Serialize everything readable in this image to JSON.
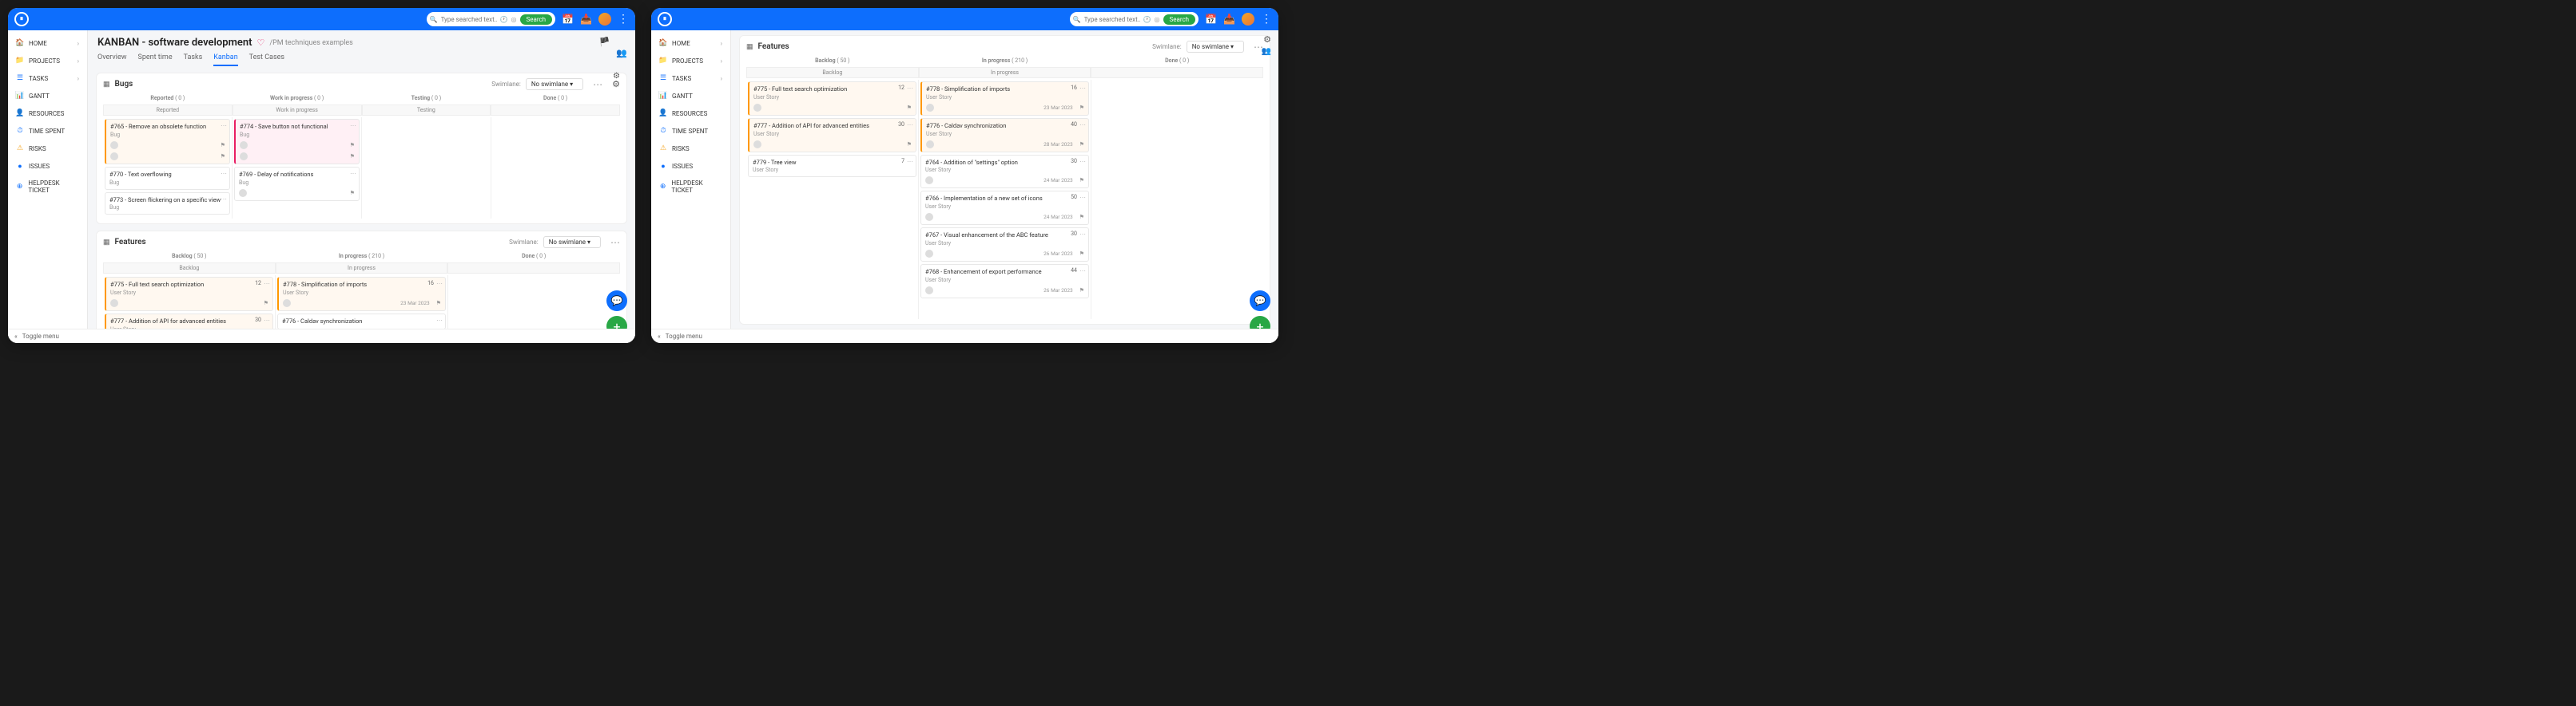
{
  "search": {
    "placeholder": "Type searched text...",
    "btn": "Search"
  },
  "sidebar": {
    "items": [
      {
        "icon": "🏠",
        "label": "HOME",
        "chev": true,
        "color": "#0d6efd"
      },
      {
        "icon": "📁",
        "label": "PROJECTS",
        "chev": true,
        "color": "#0d6efd"
      },
      {
        "icon": "☰",
        "label": "TASKS",
        "chev": true,
        "color": "#0d6efd"
      },
      {
        "icon": "📊",
        "label": "GANTT",
        "color": "#0d6efd"
      },
      {
        "icon": "👤",
        "label": "RESOURCES",
        "color": "#0d6efd"
      },
      {
        "icon": "⏱",
        "label": "TIME SPENT",
        "color": "#0d6efd"
      },
      {
        "icon": "⚠",
        "label": "RISKS",
        "color": "#f5a623"
      },
      {
        "icon": "●",
        "label": "ISSUES",
        "color": "#0d6efd"
      },
      {
        "icon": "⊕",
        "label": "HELPDESK TICKET",
        "color": "#0d6efd"
      }
    ]
  },
  "page": {
    "title": "KANBAN - software development",
    "breadcrumb": "/PM techniques examples",
    "tabs": [
      "Overview",
      "Spent time",
      "Tasks",
      "Kanban",
      "Test Cases"
    ],
    "active_tab": "Kanban"
  },
  "swim": {
    "label": "Swimlane:",
    "value": "No swimlane"
  },
  "bugs": {
    "title": "Bugs",
    "cols_head": [
      {
        "label": "Reported",
        "count": "( 0 )"
      },
      {
        "label": "Work in progress",
        "count": "( 0 )"
      },
      {
        "label": "Testing",
        "count": "( 0 )"
      },
      {
        "label": "Done",
        "count": "( 0 )"
      }
    ],
    "cols_sub": [
      "Reported",
      "Work in progress",
      "Testing",
      ""
    ],
    "col0": [
      {
        "t": "#765 - Remove an obsolete function",
        "s": "Bug",
        "cls": "orange"
      },
      {
        "t": "#770 - Text overflowing",
        "s": "Bug"
      },
      {
        "t": "#773 - Screen flickering on a specific view",
        "s": "Bug"
      }
    ],
    "col1": [
      {
        "t": "#774 - Save button not functional",
        "s": "Bug",
        "cls": "pink"
      },
      {
        "t": "#769 - Delay of notifications",
        "s": "Bug"
      }
    ]
  },
  "features_a": {
    "title": "Features",
    "cols_head": [
      {
        "label": "Backlog",
        "count": "( 50 )"
      },
      {
        "label": "In progress",
        "count": "( 210 )"
      },
      {
        "label": "Done",
        "count": "( 0 )"
      }
    ],
    "cols_sub": [
      "Backlog",
      "In progress",
      ""
    ],
    "col0": [
      {
        "t": "#775 - Full text search optimization",
        "s": "User Story",
        "b": "12",
        "cls": "orange"
      },
      {
        "t": "#777 - Addition of API for advanced entities",
        "s": "User Story",
        "b": "30",
        "cls": "orange"
      }
    ],
    "col1": [
      {
        "t": "#778 - Simplification of imports",
        "s": "User Story",
        "b": "16",
        "cls": "orange",
        "d": "23 Mar 2023"
      },
      {
        "t": "#776 - Caldav synchronization",
        "s": "",
        "b": ""
      }
    ]
  },
  "features_b": {
    "title": "Features",
    "cols_head": [
      {
        "label": "Backlog",
        "count": "( 50 )"
      },
      {
        "label": "In progress",
        "count": "( 210 )"
      },
      {
        "label": "Done",
        "count": "( 0 )"
      }
    ],
    "cols_sub": [
      "Backlog",
      "In progress"
    ],
    "col0": [
      {
        "t": "#775 - Full text search optimization",
        "s": "User Story",
        "b": "12",
        "cls": "orange"
      },
      {
        "t": "#777 - Addition of API for advanced entities",
        "s": "User Story",
        "b": "30",
        "cls": "orange"
      },
      {
        "t": "#779 - Tree view",
        "s": "User Story",
        "b": "7"
      }
    ],
    "col1": [
      {
        "t": "#778 - Simplification of imports",
        "s": "User Story",
        "b": "16",
        "cls": "orange",
        "d": "23 Mar 2023"
      },
      {
        "t": "#776 - Caldav synchronization",
        "s": "User Story",
        "b": "40",
        "cls": "orange",
        "d": "28 Mar 2023"
      },
      {
        "t": "#764 - Addition of \"settings\" option",
        "s": "User Story",
        "b": "30",
        "d": "24 Mar 2023"
      },
      {
        "t": "#766 - Implementation of a new set of icons",
        "s": "User Story",
        "b": "50",
        "d": "24 Mar 2023"
      },
      {
        "t": "#767 - Visual enhancement of the ABC feature",
        "s": "User Story",
        "b": "30",
        "d": "26 Mar 2023"
      },
      {
        "t": "#768 - Enhancement of export performance",
        "s": "User Story",
        "b": "44",
        "d": "26 Mar 2023"
      }
    ]
  },
  "footer": {
    "toggle": "Toggle menu"
  }
}
